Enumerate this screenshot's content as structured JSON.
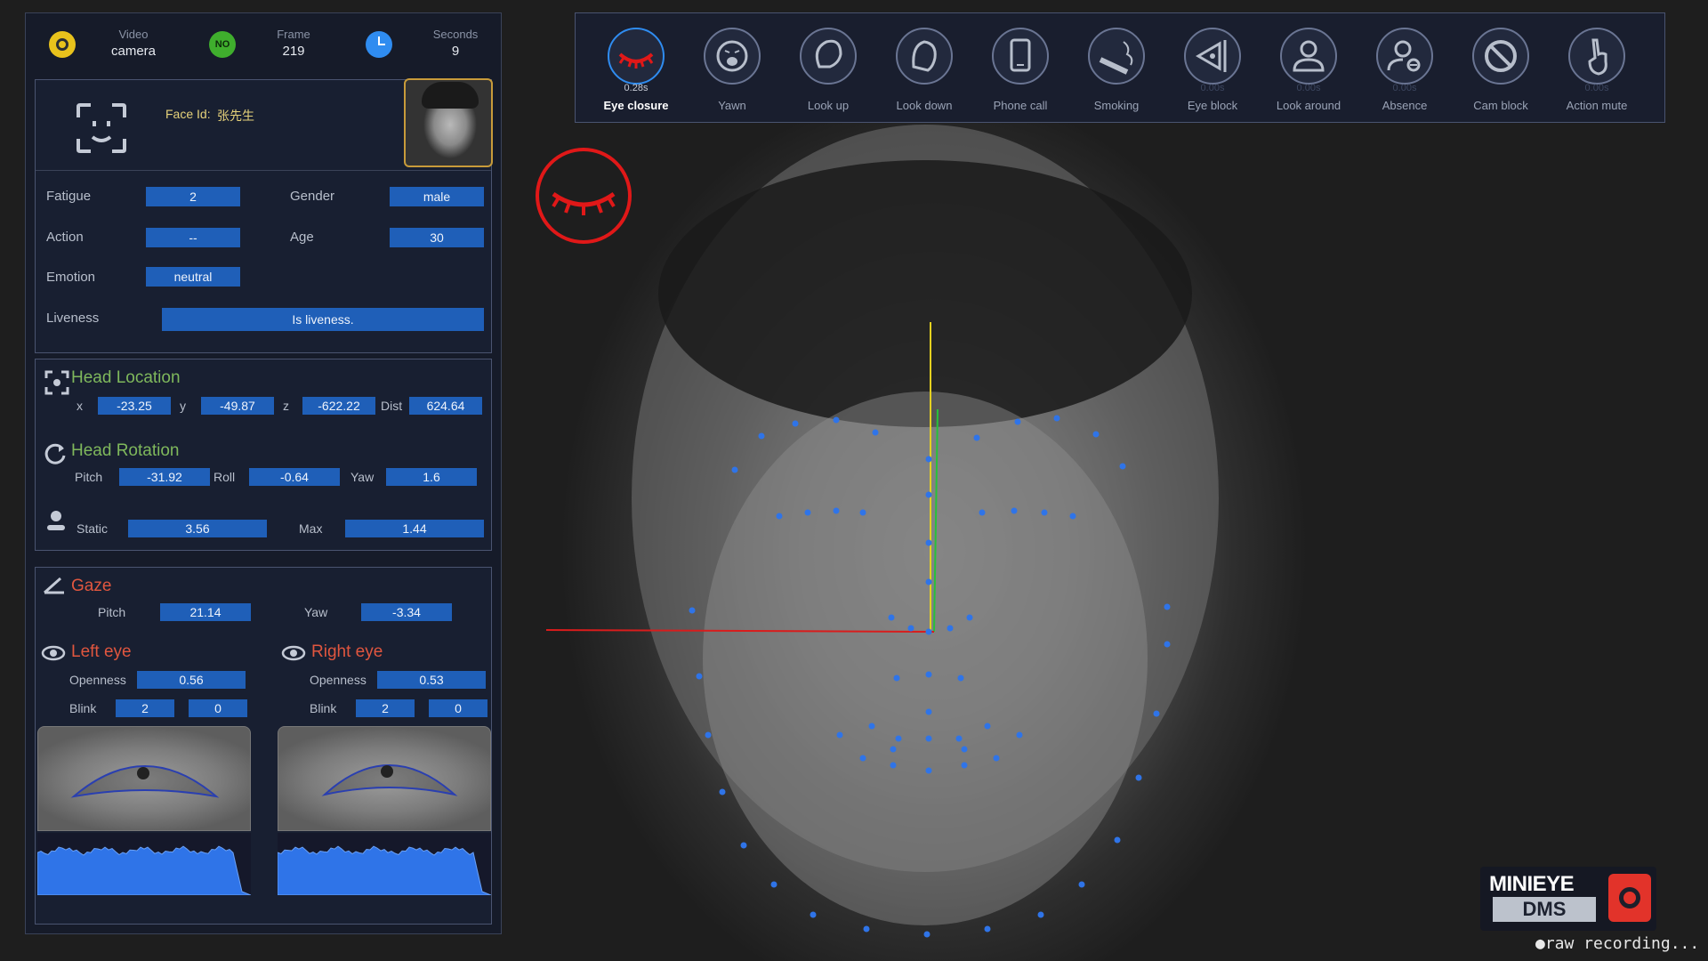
{
  "topbar": {
    "source_label": "Video",
    "source_value": "camera",
    "frame_label": "Frame",
    "frame_value": "219",
    "seconds_label": "Seconds",
    "seconds_value": "9",
    "status_badge": "NO"
  },
  "face": {
    "face_id_label": "Face Id:",
    "face_id_value": "张先生",
    "fatigue_label": "Fatigue",
    "fatigue_value": "2",
    "action_label": "Action",
    "action_value": "--",
    "emotion_label": "Emotion",
    "emotion_value": "neutral",
    "gender_label": "Gender",
    "gender_value": "male",
    "age_label": "Age",
    "age_value": "30",
    "liveness_label": "Liveness",
    "liveness_value": "Is liveness."
  },
  "head_location": {
    "title": "Head Location",
    "x_label": "x",
    "x_value": "-23.25",
    "y_label": "y",
    "y_value": "-49.87",
    "z_label": "z",
    "z_value": "-622.22",
    "dist_label": "Dist",
    "dist_value": "624.64"
  },
  "head_rotation": {
    "title": "Head Rotation",
    "pitch_label": "Pitch",
    "pitch_value": "-31.92",
    "roll_label": "Roll",
    "roll_value": "-0.64",
    "yaw_label": "Yaw",
    "yaw_value": "1.6",
    "static_label": "Static",
    "static_value": "3.56",
    "max_label": "Max",
    "max_value": "1.44"
  },
  "gaze": {
    "title": "Gaze",
    "pitch_label": "Pitch",
    "pitch_value": "21.14",
    "yaw_label": "Yaw",
    "yaw_value": "-3.34"
  },
  "left_eye": {
    "title": "Left eye",
    "openness_label": "Openness",
    "openness_value": "0.56",
    "blink_label": "Blink",
    "blink_a": "2",
    "blink_b": "0"
  },
  "right_eye": {
    "title": "Right eye",
    "openness_label": "Openness",
    "openness_value": "0.53",
    "blink_label": "Blink",
    "blink_a": "2",
    "blink_b": "0"
  },
  "toolbar": [
    {
      "label": "Eye closure",
      "time": "0.28s",
      "active": true,
      "icon": "eye-closed-icon"
    },
    {
      "label": "Yawn",
      "time": "",
      "active": false,
      "icon": "yawn-icon"
    },
    {
      "label": "Look up",
      "time": "",
      "active": false,
      "icon": "look-up-icon"
    },
    {
      "label": "Look down",
      "time": "",
      "active": false,
      "icon": "look-down-icon"
    },
    {
      "label": "Phone call",
      "time": "",
      "active": false,
      "icon": "phone-icon"
    },
    {
      "label": "Smoking",
      "time": "",
      "active": false,
      "icon": "cigarette-icon"
    },
    {
      "label": "Eye block",
      "time": "0.00s",
      "active": false,
      "icon": "eye-block-icon"
    },
    {
      "label": "Look around",
      "time": "0.00s",
      "active": false,
      "icon": "person-icon"
    },
    {
      "label": "Absence",
      "time": "0.00s",
      "active": false,
      "icon": "person-absent-icon"
    },
    {
      "label": "Cam block",
      "time": "",
      "active": false,
      "icon": "prohibited-icon"
    },
    {
      "label": "Action mute",
      "time": "0.00s",
      "active": false,
      "icon": "finger-gesture-icon"
    }
  ],
  "colors": {
    "accent_blue": "#1f5fb8",
    "alert_red": "#e01818",
    "title_green": "#7fb85c",
    "title_red": "#e0563f"
  },
  "logo": {
    "line1": "MINIEYE",
    "line2": "DMS"
  },
  "recording_text": "●raw recording..."
}
